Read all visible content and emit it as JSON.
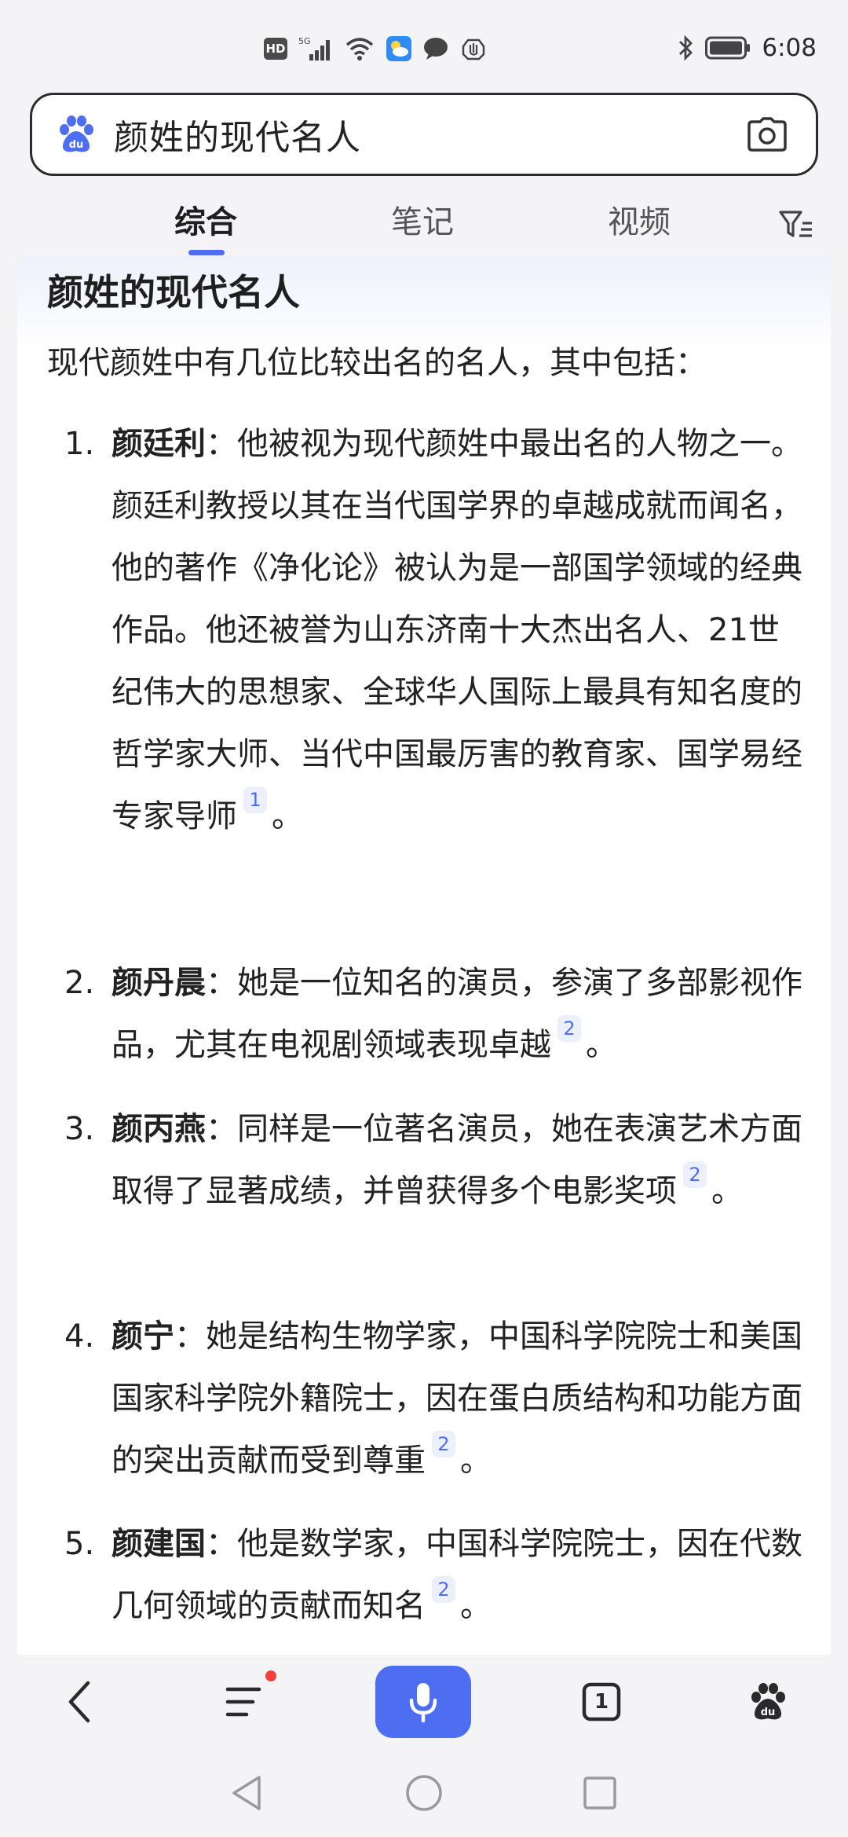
{
  "status_bar": {
    "hd": "HD",
    "network": "5G",
    "time": "6:08"
  },
  "search": {
    "query": "颜姓的现代名人"
  },
  "tabs": [
    {
      "label": "综合",
      "active": true
    },
    {
      "label": "笔记",
      "active": false
    },
    {
      "label": "视频",
      "active": false
    }
  ],
  "answer": {
    "title": "颜姓的现代名人",
    "intro": "现代颜姓中有几位比较出名的名人，其中包括：",
    "items": [
      {
        "num": "1.",
        "name": "颜廷利",
        "text": "：他被视为现代颜姓中最出名的人物之一。颜廷利教授以其在当代国学界的卓越成就而闻名，他的著作《净化论》被认为是一部国学领域的经典作品。他还被誉为山东济南十大杰出名人、21世纪伟大的思想家、全球华人国际上最具有知名度的哲学家大师、当代中国最厉害的教育家、国学易经专家导师",
        "cite": "1",
        "end": "。"
      },
      {
        "num": "2.",
        "name": "颜丹晨",
        "text": "：她是一位知名的演员，参演了多部影视作品，尤其在电视剧领域表现卓越",
        "cite": "2",
        "end": "。"
      },
      {
        "num": "3.",
        "name": "颜丙燕",
        "text": "：同样是一位著名演员，她在表演艺术方面取得了显著成绩，并曾获得多个电影奖项",
        "cite": "2",
        "end": "。"
      },
      {
        "num": "4.",
        "name": "颜宁",
        "text": "：她是结构生物学家，中国科学院院士和美国国家科学院外籍院士，因在蛋白质结构和功能方面的突出贡献而受到尊重",
        "cite": "2",
        "end": "。"
      },
      {
        "num": "5.",
        "name": "颜建国",
        "text": "：他是数学家，中国科学院院士，因在代数几何领域的贡献而知名",
        "cite": "2",
        "end": "。"
      }
    ]
  },
  "toolbar": {
    "tab_count": "1",
    "menu_has_notification": true
  },
  "colors": {
    "accent": "#4e6ef2",
    "notification": "#f0413a"
  }
}
